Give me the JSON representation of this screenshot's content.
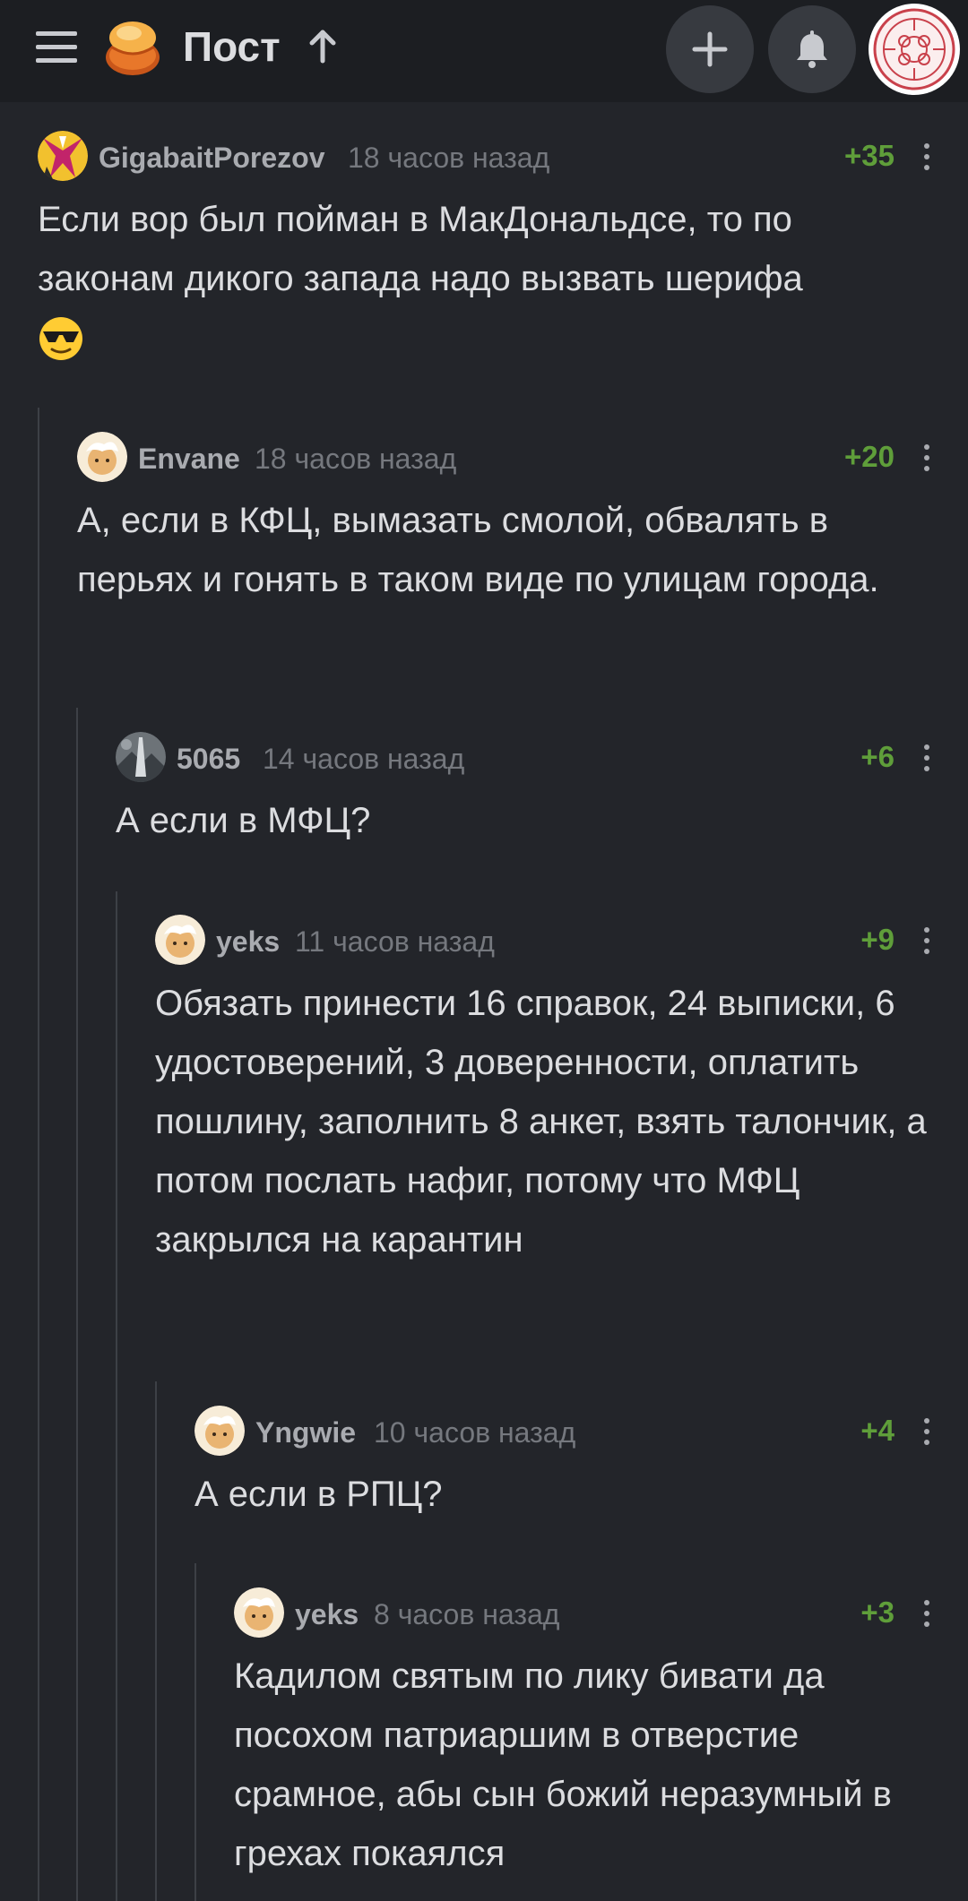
{
  "header": {
    "title": "Пост",
    "icons": {
      "menu": "hamburger-menu-icon",
      "logo": "pikabu-logo",
      "up": "arrow-up-icon",
      "add": "plus-icon",
      "notifications": "bell-icon",
      "profile": "profile-avatar"
    }
  },
  "colors": {
    "background": "#23252a",
    "header": "#1c1e22",
    "rating": "#5f9e3a",
    "thread_line": "#3d4046"
  },
  "comments": [
    {
      "username": "GigabaitPorezov",
      "time": "18 часов назад",
      "rating": "+35",
      "text": "Если вор был пойман в МакДональдсе, то по законам дикого запада надо вызвать шерифа",
      "emoji": "sunglasses-emoji"
    },
    {
      "username": "Envane",
      "time": "18 часов назад",
      "rating": "+20",
      "text": "А, если в КФЦ, вымазать смолой, обвалять в перьях и гонять в таком виде по улицам города."
    },
    {
      "username": "5065",
      "time": "14 часов назад",
      "rating": "+6",
      "text": "А если в МФЦ?"
    },
    {
      "username": "yeks",
      "time": "11 часов назад",
      "rating": "+9",
      "text": "Обязать принести 16 справок, 24 выписки, 6 удостоверений, 3 доверенности, оплатить пошлину, заполнить 8 анкет, взять талончик, а потом послать нафиг, потому что МФЦ закрылся на карантин"
    },
    {
      "username": "Yngwie",
      "time": "10 часов назад",
      "rating": "+4",
      "text": "А если в РПЦ?"
    },
    {
      "username": "yeks",
      "time": "8 часов назад",
      "rating": "+3",
      "text": "Кадилом святым по лику бивати да посохом патриаршим в отверстие срамное, абы сын божий неразумный в грехах покаялся"
    }
  ]
}
